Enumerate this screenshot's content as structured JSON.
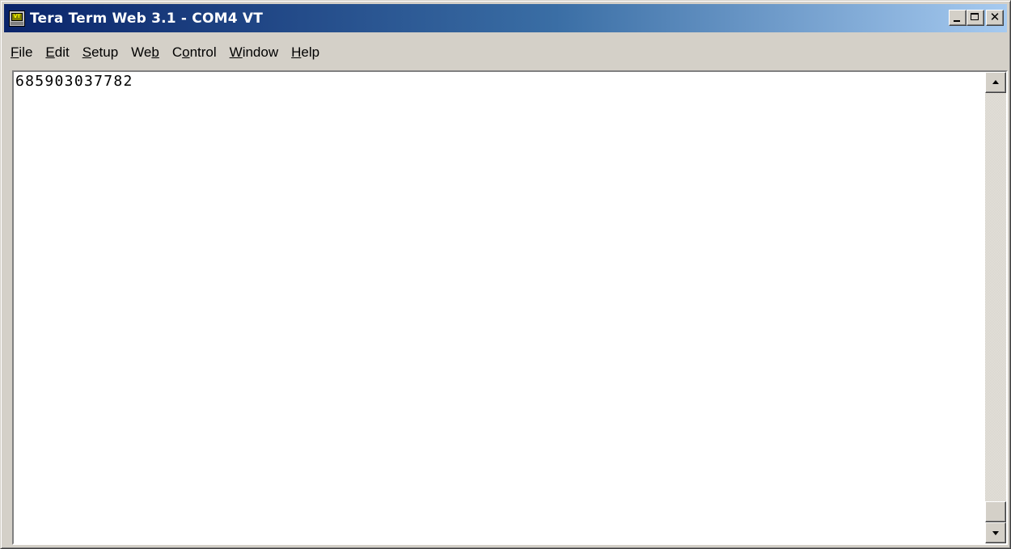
{
  "window": {
    "title": "Tera Term Web 3.1 - COM4 VT",
    "icon": "tera-term-app-icon",
    "icon_label": "VT",
    "controls": {
      "minimize_icon": "minimize-icon",
      "maximize_icon": "maximize-icon",
      "close_icon": "close-icon",
      "close_glyph": "✕"
    }
  },
  "menu": {
    "items": [
      {
        "id": "file",
        "pre": "",
        "accel": "F",
        "post": "ile"
      },
      {
        "id": "edit",
        "pre": "",
        "accel": "E",
        "post": "dit"
      },
      {
        "id": "setup",
        "pre": "",
        "accel": "S",
        "post": "etup"
      },
      {
        "id": "web",
        "pre": "We",
        "accel": "b",
        "post": ""
      },
      {
        "id": "control",
        "pre": "C",
        "accel": "o",
        "post": "ntrol"
      },
      {
        "id": "window",
        "pre": "",
        "accel": "W",
        "post": "indow"
      },
      {
        "id": "help",
        "pre": "",
        "accel": "H",
        "post": "elp"
      }
    ]
  },
  "terminal": {
    "output": "685903037782"
  },
  "colors": {
    "title_start": "#0a246a",
    "title_end": "#a6caf0",
    "face": "#d4d0c8",
    "terminal_bg": "#ffffff"
  }
}
